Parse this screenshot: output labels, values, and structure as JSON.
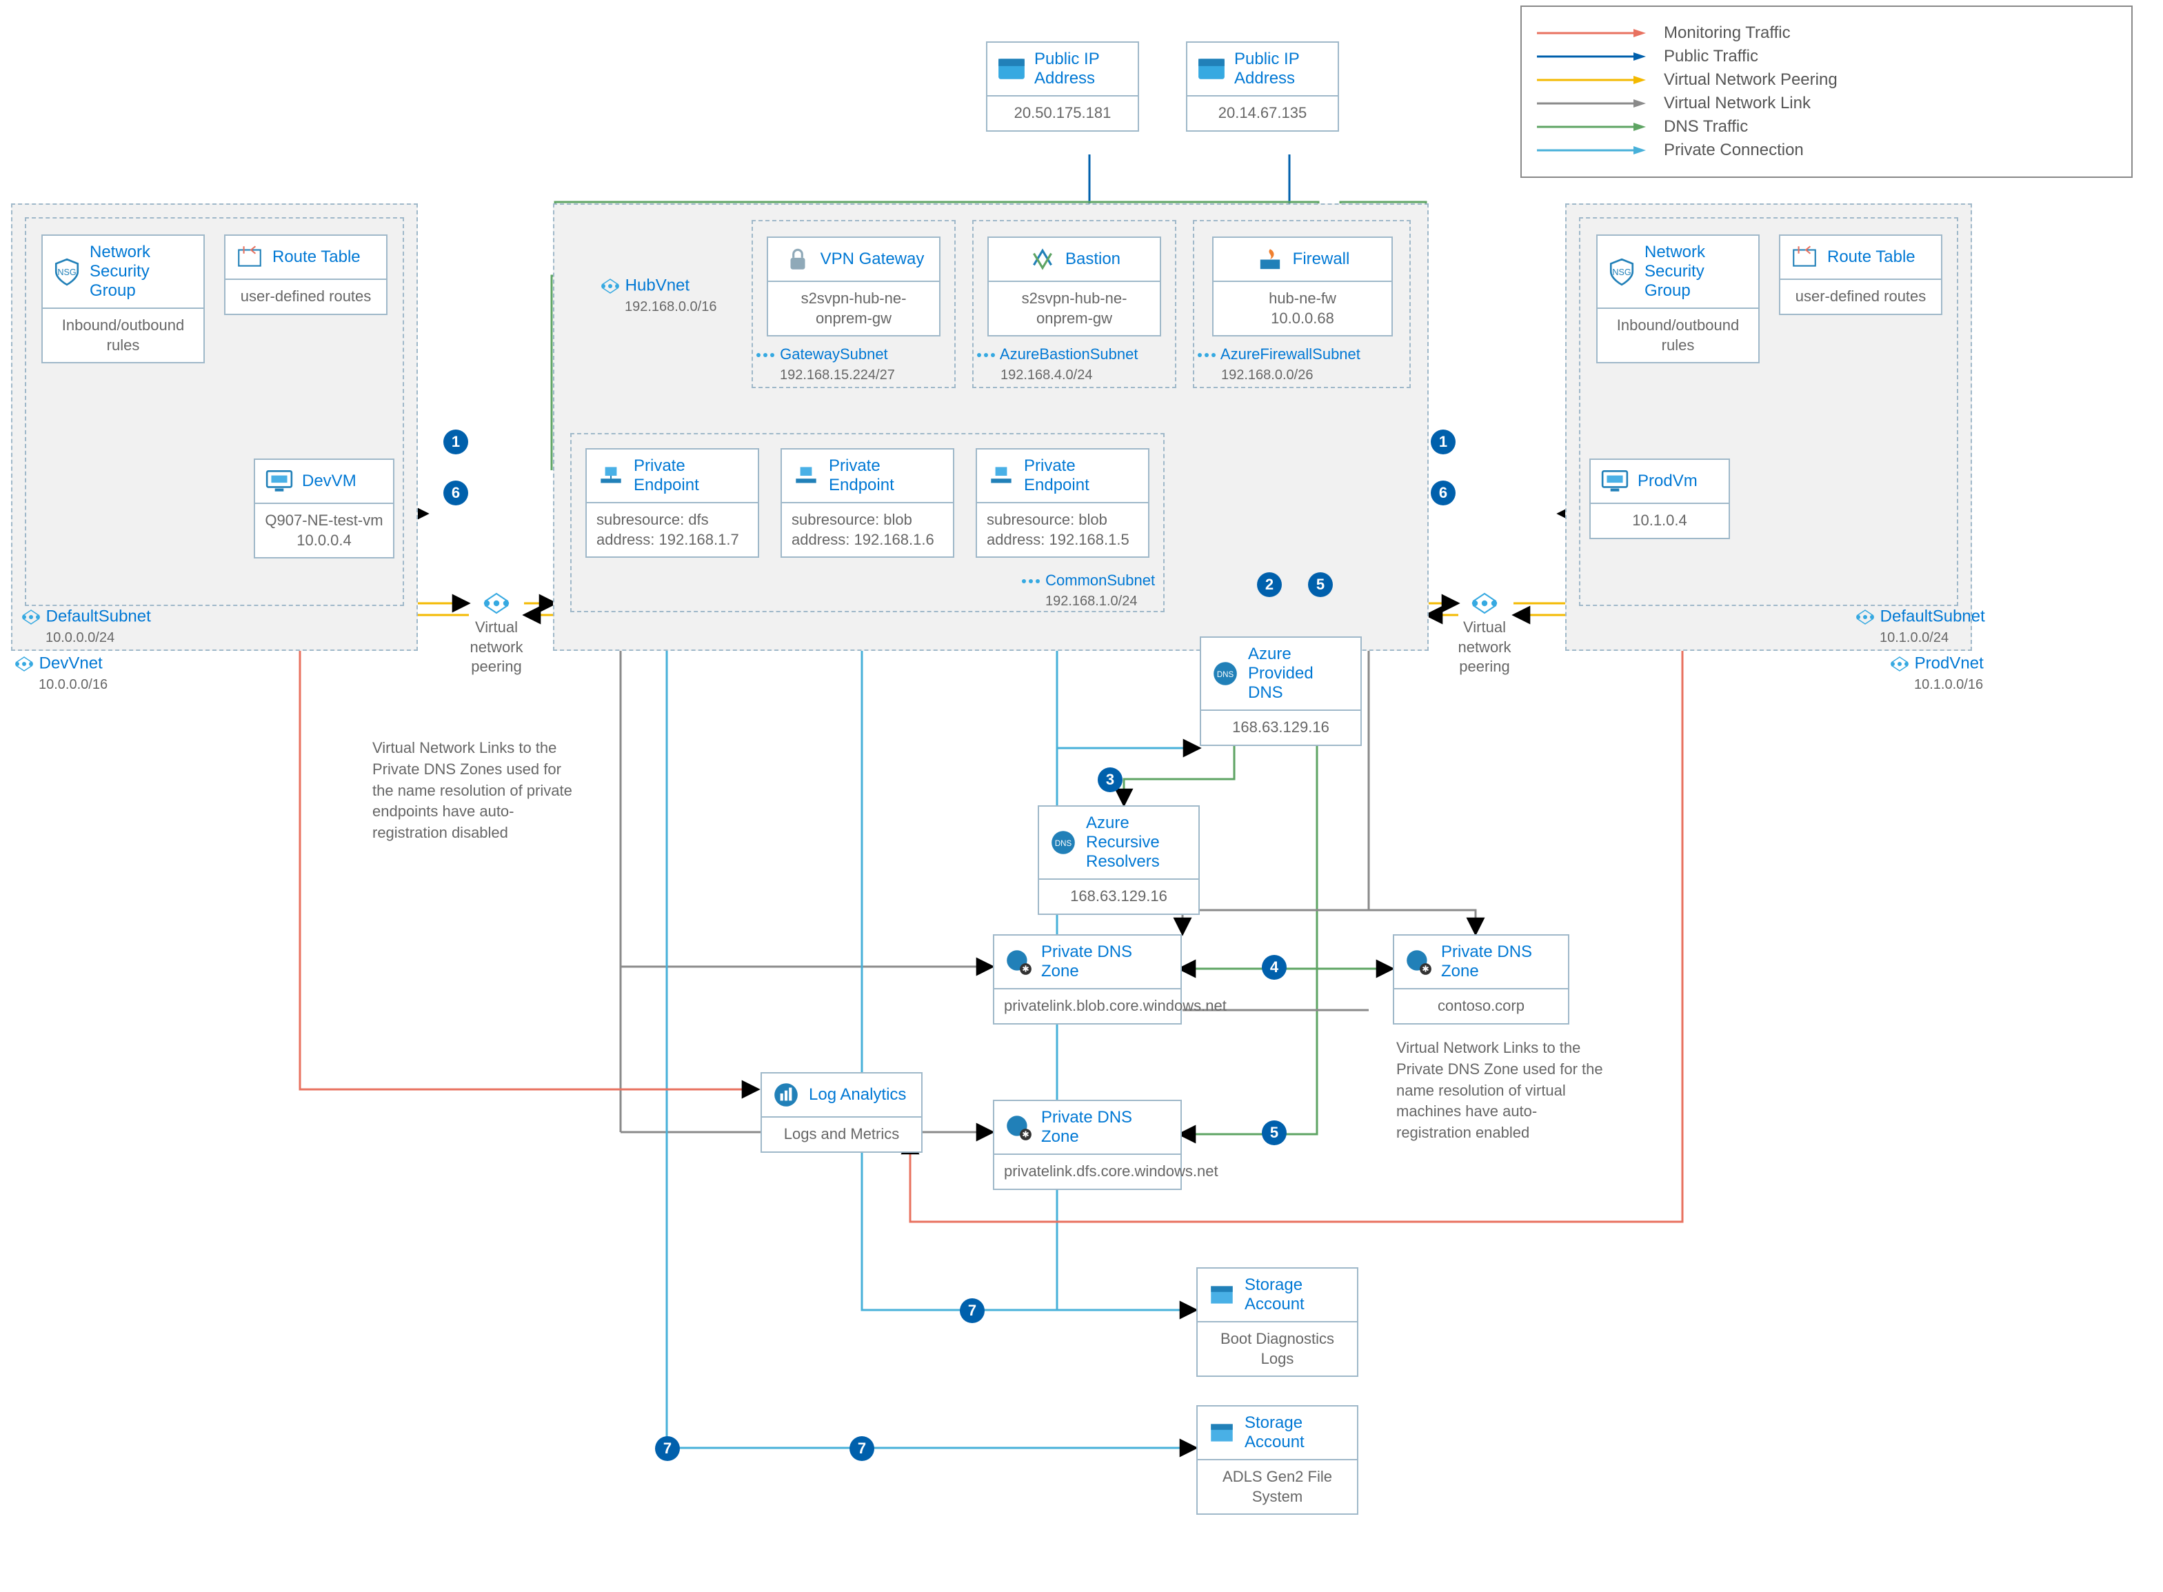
{
  "legend": {
    "items": [
      {
        "label": "Monitoring Traffic",
        "color": "#e8715f"
      },
      {
        "label": "Public Traffic",
        "color": "#0060ac"
      },
      {
        "label": "Virtual Network Peering",
        "color": "#f3b900"
      },
      {
        "label": "Virtual Network Link",
        "color": "#8a8a8a"
      },
      {
        "label": "DNS Traffic",
        "color": "#5ea463"
      },
      {
        "label": "Private Connection",
        "color": "#47b0d9"
      }
    ]
  },
  "pip1": {
    "title": "Public IP Address",
    "value": "20.50.175.181"
  },
  "pip2": {
    "title": "Public IP Address",
    "value": "20.14.67.135"
  },
  "nsg": {
    "title": "Network Security Group",
    "sub": "Inbound/outbound rules"
  },
  "rt": {
    "title": "Route Table",
    "sub": "user-defined routes"
  },
  "devvm": {
    "title": "DevVM",
    "l1": "Q907-NE-test-vm",
    "l2": "10.0.0.4"
  },
  "prodvm": {
    "title": "ProdVm",
    "l1": "10.1.0.4"
  },
  "hub": {
    "title": "HubVnet",
    "cidr": "192.168.0.0/16"
  },
  "devvnet": {
    "title": "DevVnet",
    "cidr": "10.0.0.0/16"
  },
  "prodvnet": {
    "title": "ProdVnet",
    "cidr": "10.1.0.0/16"
  },
  "defaultsubnet_dev": {
    "title": "DefaultSubnet",
    "cidr": "10.0.0.0/24"
  },
  "defaultsubnet_prod": {
    "title": "DefaultSubnet",
    "cidr": "10.1.0.0/24"
  },
  "commonsubnet": {
    "title": "CommonSubnet",
    "cidr": "192.168.1.0/24"
  },
  "gwsubnet": {
    "title": "GatewaySubnet",
    "cidr": "192.168.15.224/27"
  },
  "bastsubnet": {
    "title": "AzureBastionSubnet",
    "cidr": "192.168.4.0/24"
  },
  "fwsubnet": {
    "title": "AzureFirewallSubnet",
    "cidr": "192.168.0.0/26"
  },
  "vpn": {
    "title": "VPN Gateway",
    "l1": "s2svpn-hub-ne-onprem-gw"
  },
  "bastion": {
    "title": "Bastion",
    "l1": "s2svpn-hub-ne-onprem-gw"
  },
  "fw": {
    "title": "Firewall",
    "l1": "hub-ne-fw",
    "l2": "10.0.0.68"
  },
  "pe_dfs": {
    "title": "Private Endpoint",
    "l1": "subresource: dfs",
    "l2": "address: 192.168.1.7"
  },
  "pe_blob": {
    "title": "Private Endpoint",
    "l1": "subresource: blob",
    "l2": "address: 192.168.1.6"
  },
  "pe_blob2": {
    "title": "Private Endpoint",
    "l1": "subresource: blob",
    "l2": "address: 192.168.1.5"
  },
  "vnp": {
    "title": "Virtual network peering"
  },
  "azdns": {
    "title": "Azure Provided DNS",
    "value": "168.63.129.16"
  },
  "resolver": {
    "title": "Azure Recursive Resolvers",
    "value": "168.63.129.16"
  },
  "pdz_blob": {
    "title": "Private DNS Zone",
    "value": "privatelink.blob.core.windows.net"
  },
  "pdz_dfs": {
    "title": "Private DNS Zone",
    "value": "privatelink.dfs.core.windows.net"
  },
  "pdz_contoso": {
    "title": "Private DNS Zone",
    "value": "contoso.corp"
  },
  "log": {
    "title": "Log Analytics",
    "value": "Logs and Metrics"
  },
  "sa1": {
    "title": "Storage Account",
    "value": "Boot Diagnostics Logs"
  },
  "sa2": {
    "title": "Storage Account",
    "value": "ADLS Gen2 File System"
  },
  "note1": "Virtual Network Links to the Private DNS Zones used for the name resolution of private endpoints have auto-registration disabled",
  "note2": "Virtual Network Links to the Private DNS Zone used for the name resolution of virtual machines have auto-registration enabled"
}
